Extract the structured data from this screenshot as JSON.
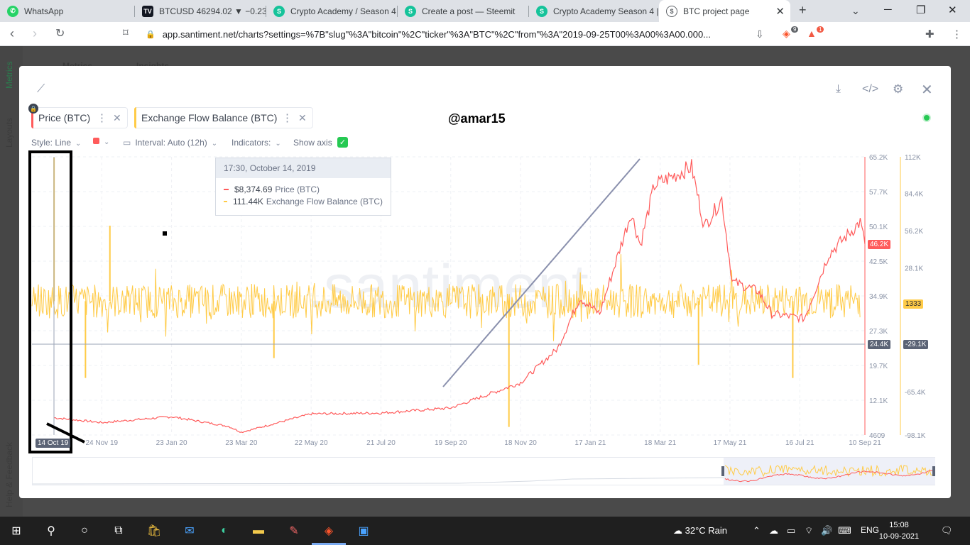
{
  "browser": {
    "tabs": [
      {
        "label": "WhatsApp",
        "color": "#25d366"
      },
      {
        "label": "BTCUSD 46294.02 ▼ −0.23",
        "color": "#131722"
      },
      {
        "label": "Crypto Academy / Season 4",
        "color": "#15c39a"
      },
      {
        "label": "Create a post — Steemit",
        "color": "#15c39a"
      },
      {
        "label": "Crypto Academy Season 4 |",
        "color": "#15c39a"
      },
      {
        "label": "BTC project page",
        "color": "#5f6368"
      }
    ],
    "url": "app.santiment.net/charts?settings=%7B\"slug\"%3A\"bitcoin\"%2C\"ticker\"%3A\"BTC\"%2C\"from\"%3A\"2019-09-25T00%3A00%3A00.000...",
    "brave_badge": "9",
    "alert_badge": "1"
  },
  "background_page": {
    "tabs": [
      "Metrics",
      "Insights"
    ],
    "rail_labels": [
      "Metrics",
      "Layouts",
      "Help & Feedback"
    ]
  },
  "modal": {
    "watermark_text": "@amar15",
    "brand_watermark": ".santiment.",
    "metrics": [
      {
        "label": "Price (BTC)",
        "color": "#ff5b5b"
      },
      {
        "label": "Exchange Flow Balance (BTC)",
        "color": "#ffcb47"
      }
    ],
    "controls": {
      "style": "Style: Line",
      "interval": "Interval: Auto (12h)",
      "indicators": "Indicators:",
      "show_axis": "Show axis"
    },
    "tooltip": {
      "date": "17:30, October 14, 2019",
      "price_value": "$8,374.69",
      "price_name": "Price (BTC)",
      "flow_value": "111.44K",
      "flow_name": "Exchange Flow Balance (BTC)"
    },
    "tags": {
      "price_last": "46.2K",
      "flow_last": "1333",
      "cross_price": "24.4K",
      "cross_flow": "-29.1K",
      "cross_date": "14 Oct 19"
    }
  },
  "chart_data": {
    "type": "line",
    "x_ticks": [
      "24 Nov 19",
      "23 Jan 20",
      "23 Mar 20",
      "22 May 20",
      "21 Jul 20",
      "19 Sep 20",
      "18 Nov 20",
      "17 Jan 21",
      "18 Mar 21",
      "17 May 21",
      "16 Jul 21",
      "10 Sep 21"
    ],
    "y_left_ticks": [
      "65.2K",
      "57.7K",
      "50.1K",
      "42.5K",
      "34.9K",
      "27.3K",
      "19.7K",
      "12.1K",
      "4609"
    ],
    "y_right_ticks": [
      "112K",
      "84.4K",
      "56.2K",
      "28.1K",
      "-65.4K",
      "-98.1K"
    ],
    "series": [
      {
        "name": "Price (BTC)",
        "color": "#ff5b5b",
        "x": [
          "2019-10-14",
          "2019-11-24",
          "2020-01-23",
          "2020-03-12",
          "2020-03-23",
          "2020-05-22",
          "2020-07-21",
          "2020-09-19",
          "2020-11-18",
          "2020-12-20",
          "2021-01-08",
          "2021-01-25",
          "2021-02-21",
          "2021-03-01",
          "2021-03-13",
          "2021-04-14",
          "2021-04-25",
          "2021-05-10",
          "2021-05-19",
          "2021-06-10",
          "2021-06-22",
          "2021-07-20",
          "2021-08-10",
          "2021-09-06",
          "2021-09-10"
        ],
        "y": [
          8374,
          7300,
          8600,
          6500,
          5200,
          9200,
          9400,
          10500,
          16000,
          23500,
          34500,
          31000,
          53000,
          46000,
          59000,
          63000,
          50000,
          56000,
          38000,
          36000,
          31000,
          30000,
          44000,
          51000,
          46200
        ]
      },
      {
        "name": "Exchange Flow Balance (BTC)",
        "color": "#ffcb47",
        "note_values_range": [
          -98100,
          112000
        ],
        "spikes": [
          {
            "x": "2019-10-14",
            "y": 111440
          },
          {
            "x": "2019-12-01",
            "y": 60000
          },
          {
            "x": "2019-11-10",
            "y": -55000
          },
          {
            "x": "2020-04-20",
            "y": -40000
          },
          {
            "x": "2020-11-08",
            "y": -92000
          },
          {
            "x": "2021-04-20",
            "y": -45000
          },
          {
            "x": "2021-07-10",
            "y": -55000
          }
        ],
        "last": 1333
      }
    ]
  },
  "taskbar": {
    "weather": "32°C  Rain",
    "lang": "ENG",
    "time": "15:08",
    "date": "10-09-2021"
  }
}
